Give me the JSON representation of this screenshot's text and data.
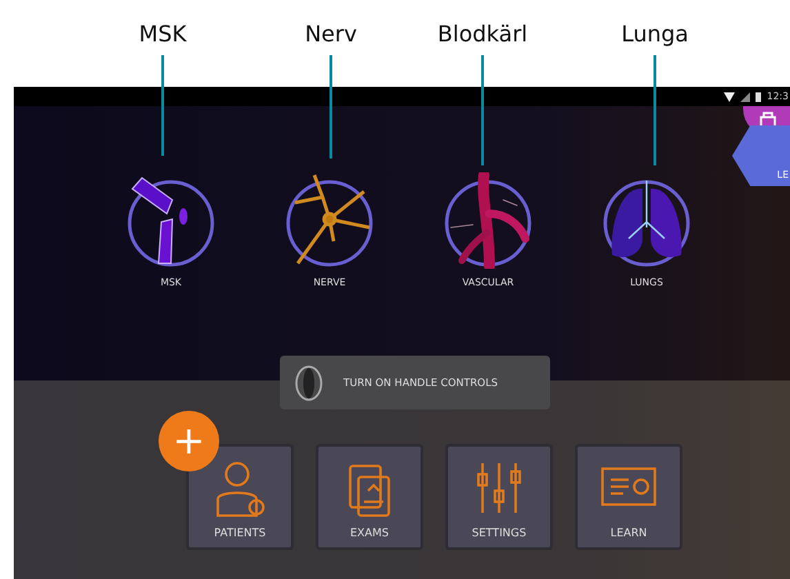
{
  "annotations": [
    {
      "label": "MSK"
    },
    {
      "label": "Nerv"
    },
    {
      "label": "Blodkärl"
    },
    {
      "label": "Lunga"
    }
  ],
  "status_bar": {
    "time": "12:3"
  },
  "side_badge": {
    "label": "LE"
  },
  "categories": [
    {
      "label": "MSK",
      "kind": "msk"
    },
    {
      "label": "NERVE",
      "kind": "nerve"
    },
    {
      "label": "VASCULAR",
      "kind": "vascular"
    },
    {
      "label": "LUNGS",
      "kind": "lungs"
    }
  ],
  "handle_toggle": {
    "label": "TURN ON HANDLE CONTROLS"
  },
  "add_button": {
    "label": "+"
  },
  "tiles": [
    {
      "label": "PATIENTS",
      "kind": "patients"
    },
    {
      "label": "EXAMS",
      "kind": "exams"
    },
    {
      "label": "SETTINGS",
      "kind": "settings"
    },
    {
      "label": "LEARN",
      "kind": "learn"
    }
  ]
}
